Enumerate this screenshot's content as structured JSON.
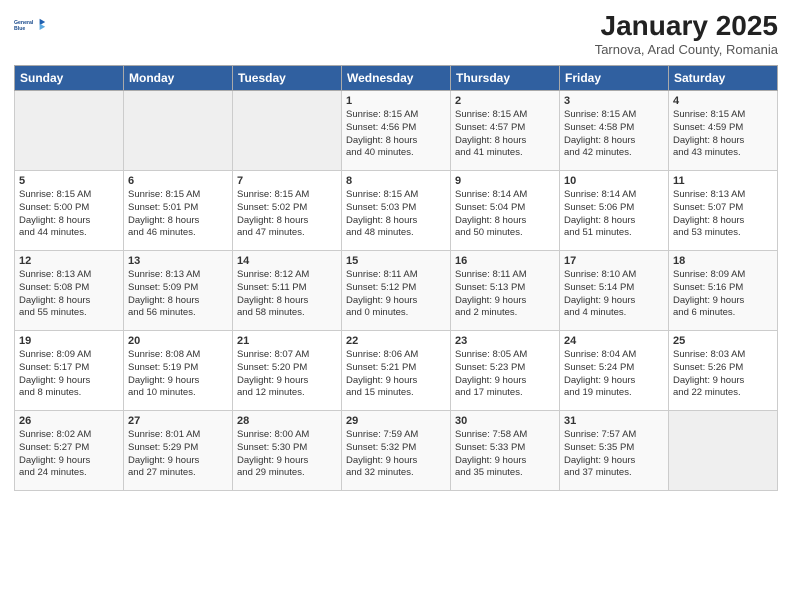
{
  "header": {
    "logo_line1": "General",
    "logo_line2": "Blue",
    "main_title": "January 2025",
    "subtitle": "Tarnova, Arad County, Romania"
  },
  "weekdays": [
    "Sunday",
    "Monday",
    "Tuesday",
    "Wednesday",
    "Thursday",
    "Friday",
    "Saturday"
  ],
  "weeks": [
    [
      {
        "day": "",
        "info": ""
      },
      {
        "day": "",
        "info": ""
      },
      {
        "day": "",
        "info": ""
      },
      {
        "day": "1",
        "info": "Sunrise: 8:15 AM\nSunset: 4:56 PM\nDaylight: 8 hours\nand 40 minutes."
      },
      {
        "day": "2",
        "info": "Sunrise: 8:15 AM\nSunset: 4:57 PM\nDaylight: 8 hours\nand 41 minutes."
      },
      {
        "day": "3",
        "info": "Sunrise: 8:15 AM\nSunset: 4:58 PM\nDaylight: 8 hours\nand 42 minutes."
      },
      {
        "day": "4",
        "info": "Sunrise: 8:15 AM\nSunset: 4:59 PM\nDaylight: 8 hours\nand 43 minutes."
      }
    ],
    [
      {
        "day": "5",
        "info": "Sunrise: 8:15 AM\nSunset: 5:00 PM\nDaylight: 8 hours\nand 44 minutes."
      },
      {
        "day": "6",
        "info": "Sunrise: 8:15 AM\nSunset: 5:01 PM\nDaylight: 8 hours\nand 46 minutes."
      },
      {
        "day": "7",
        "info": "Sunrise: 8:15 AM\nSunset: 5:02 PM\nDaylight: 8 hours\nand 47 minutes."
      },
      {
        "day": "8",
        "info": "Sunrise: 8:15 AM\nSunset: 5:03 PM\nDaylight: 8 hours\nand 48 minutes."
      },
      {
        "day": "9",
        "info": "Sunrise: 8:14 AM\nSunset: 5:04 PM\nDaylight: 8 hours\nand 50 minutes."
      },
      {
        "day": "10",
        "info": "Sunrise: 8:14 AM\nSunset: 5:06 PM\nDaylight: 8 hours\nand 51 minutes."
      },
      {
        "day": "11",
        "info": "Sunrise: 8:13 AM\nSunset: 5:07 PM\nDaylight: 8 hours\nand 53 minutes."
      }
    ],
    [
      {
        "day": "12",
        "info": "Sunrise: 8:13 AM\nSunset: 5:08 PM\nDaylight: 8 hours\nand 55 minutes."
      },
      {
        "day": "13",
        "info": "Sunrise: 8:13 AM\nSunset: 5:09 PM\nDaylight: 8 hours\nand 56 minutes."
      },
      {
        "day": "14",
        "info": "Sunrise: 8:12 AM\nSunset: 5:11 PM\nDaylight: 8 hours\nand 58 minutes."
      },
      {
        "day": "15",
        "info": "Sunrise: 8:11 AM\nSunset: 5:12 PM\nDaylight: 9 hours\nand 0 minutes."
      },
      {
        "day": "16",
        "info": "Sunrise: 8:11 AM\nSunset: 5:13 PM\nDaylight: 9 hours\nand 2 minutes."
      },
      {
        "day": "17",
        "info": "Sunrise: 8:10 AM\nSunset: 5:14 PM\nDaylight: 9 hours\nand 4 minutes."
      },
      {
        "day": "18",
        "info": "Sunrise: 8:09 AM\nSunset: 5:16 PM\nDaylight: 9 hours\nand 6 minutes."
      }
    ],
    [
      {
        "day": "19",
        "info": "Sunrise: 8:09 AM\nSunset: 5:17 PM\nDaylight: 9 hours\nand 8 minutes."
      },
      {
        "day": "20",
        "info": "Sunrise: 8:08 AM\nSunset: 5:19 PM\nDaylight: 9 hours\nand 10 minutes."
      },
      {
        "day": "21",
        "info": "Sunrise: 8:07 AM\nSunset: 5:20 PM\nDaylight: 9 hours\nand 12 minutes."
      },
      {
        "day": "22",
        "info": "Sunrise: 8:06 AM\nSunset: 5:21 PM\nDaylight: 9 hours\nand 15 minutes."
      },
      {
        "day": "23",
        "info": "Sunrise: 8:05 AM\nSunset: 5:23 PM\nDaylight: 9 hours\nand 17 minutes."
      },
      {
        "day": "24",
        "info": "Sunrise: 8:04 AM\nSunset: 5:24 PM\nDaylight: 9 hours\nand 19 minutes."
      },
      {
        "day": "25",
        "info": "Sunrise: 8:03 AM\nSunset: 5:26 PM\nDaylight: 9 hours\nand 22 minutes."
      }
    ],
    [
      {
        "day": "26",
        "info": "Sunrise: 8:02 AM\nSunset: 5:27 PM\nDaylight: 9 hours\nand 24 minutes."
      },
      {
        "day": "27",
        "info": "Sunrise: 8:01 AM\nSunset: 5:29 PM\nDaylight: 9 hours\nand 27 minutes."
      },
      {
        "day": "28",
        "info": "Sunrise: 8:00 AM\nSunset: 5:30 PM\nDaylight: 9 hours\nand 29 minutes."
      },
      {
        "day": "29",
        "info": "Sunrise: 7:59 AM\nSunset: 5:32 PM\nDaylight: 9 hours\nand 32 minutes."
      },
      {
        "day": "30",
        "info": "Sunrise: 7:58 AM\nSunset: 5:33 PM\nDaylight: 9 hours\nand 35 minutes."
      },
      {
        "day": "31",
        "info": "Sunrise: 7:57 AM\nSunset: 5:35 PM\nDaylight: 9 hours\nand 37 minutes."
      },
      {
        "day": "",
        "info": ""
      }
    ]
  ]
}
